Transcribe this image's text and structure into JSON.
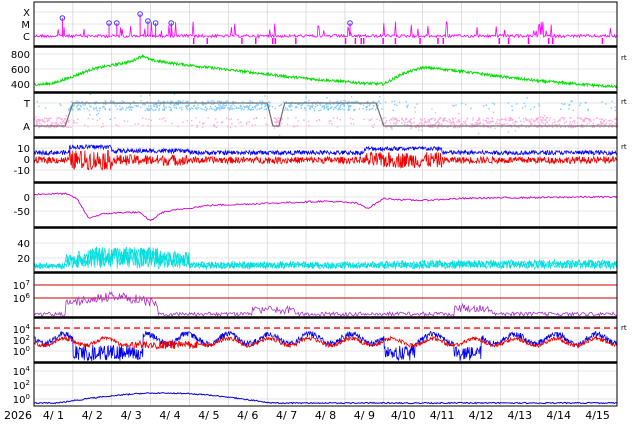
{
  "chart_data": {
    "type": "line",
    "x_start_label": "2026",
    "x_ticks": [
      "4/ 1",
      "4/ 2",
      "4/ 3",
      "4/ 4",
      "4/ 5",
      "4/ 6",
      "4/ 7",
      "4/ 8",
      "4/ 9",
      "4/10",
      "4/11",
      "4/12",
      "4/13",
      "4/14",
      "4/15"
    ],
    "x_range_days": [
      0,
      15
    ],
    "side_marker": "rt",
    "panels": [
      {
        "id": "flare",
        "ticks": [
          "X",
          "M",
          "C"
        ],
        "colors": {
          "line": "#ff00ff",
          "marker": "#3b3bff"
        },
        "flare_markers_day": [
          0.73,
          1.93,
          2.13,
          2.73,
          2.93,
          3.13,
          3.53,
          8.13
        ]
      },
      {
        "id": "sw-speed",
        "ticks": [
          "800",
          "600",
          "400"
        ],
        "ylim": [
          300,
          850
        ],
        "series": [
          {
            "color": "#00dd00",
            "keys_day_value": [
              [
                0.2,
                395
              ],
              [
                0.5,
                410
              ],
              [
                1.0,
                500
              ],
              [
                1.5,
                600
              ],
              [
                2.0,
                650
              ],
              [
                2.5,
                700
              ],
              [
                2.8,
                780
              ],
              [
                3.0,
                720
              ],
              [
                3.5,
                680
              ],
              [
                4.5,
                620
              ],
              [
                5.5,
                560
              ],
              [
                6.5,
                500
              ],
              [
                7.5,
                450
              ],
              [
                8.5,
                410
              ],
              [
                9.0,
                400
              ],
              [
                9.5,
                540
              ],
              [
                10.0,
                620
              ],
              [
                10.5,
                600
              ],
              [
                11.0,
                570
              ],
              [
                12.0,
                500
              ],
              [
                13.0,
                440
              ],
              [
                14.0,
                400
              ],
              [
                15.0,
                360
              ]
            ]
          }
        ]
      },
      {
        "id": "imf-sector",
        "ticks": [
          "T",
          "A"
        ],
        "series": [
          {
            "color": "#80ccff"
          },
          {
            "color": "#ffaadd"
          },
          {
            "color": "#707070",
            "keys_day_state": [
              [
                0,
                0
              ],
              [
                0.8,
                0
              ],
              [
                1.0,
                1
              ],
              [
                6.0,
                1
              ],
              [
                6.15,
                0
              ],
              [
                6.3,
                0
              ],
              [
                6.45,
                1
              ],
              [
                8.8,
                1
              ],
              [
                9.0,
                0
              ],
              [
                15,
                0
              ]
            ]
          }
        ]
      },
      {
        "id": "imf-bz",
        "ticks": [
          "10",
          "0",
          "-10"
        ],
        "ylim": [
          -15,
          15
        ],
        "series": [
          {
            "color": "#0000ee"
          },
          {
            "color": "#ee0000"
          }
        ]
      },
      {
        "id": "dst",
        "ticks": [
          "0",
          "-50"
        ],
        "ylim": [
          -110,
          30
        ],
        "series": [
          {
            "color": "#cc00cc",
            "keys_day_value": [
              [
                0,
                10
              ],
              [
                0.8,
                12
              ],
              [
                1.1,
                -5
              ],
              [
                1.4,
                -75
              ],
              [
                1.8,
                -60
              ],
              [
                2.3,
                -55
              ],
              [
                2.7,
                -55
              ],
              [
                3.0,
                -85
              ],
              [
                3.3,
                -55
              ],
              [
                3.7,
                -45
              ],
              [
                4.5,
                -30
              ],
              [
                5.5,
                -25
              ],
              [
                6.5,
                -20
              ],
              [
                7.5,
                -15
              ],
              [
                8.3,
                -22
              ],
              [
                8.6,
                -40
              ],
              [
                9.0,
                -5
              ],
              [
                9.5,
                -10
              ],
              [
                10,
                -12
              ],
              [
                11,
                -5
              ],
              [
                12,
                -3
              ],
              [
                13,
                -2
              ],
              [
                14,
                0
              ],
              [
                15,
                0
              ]
            ]
          }
        ]
      },
      {
        "id": "kp",
        "ticks": [
          "40",
          "20"
        ],
        "ylim": [
          0,
          55
        ],
        "series": [
          {
            "color": "#00dddd"
          }
        ]
      },
      {
        "id": "xray-flux",
        "ticks": [
          "10^7",
          "10^6"
        ],
        "series": [
          {
            "color": "#aa33cc"
          }
        ],
        "threshold_color": "#cc0000"
      },
      {
        "id": "proton-flux",
        "ticks": [
          "10^4",
          "10^2",
          "10^0"
        ],
        "series": [
          {
            "color": "#0000ee"
          },
          {
            "color": "#ee0000"
          }
        ],
        "threshold_color": "#ee0000"
      },
      {
        "id": "electron-flux",
        "ticks": [
          "10^4",
          "10^2",
          "10^0"
        ],
        "series": [
          {
            "color": "#0000cc"
          }
        ]
      }
    ]
  }
}
